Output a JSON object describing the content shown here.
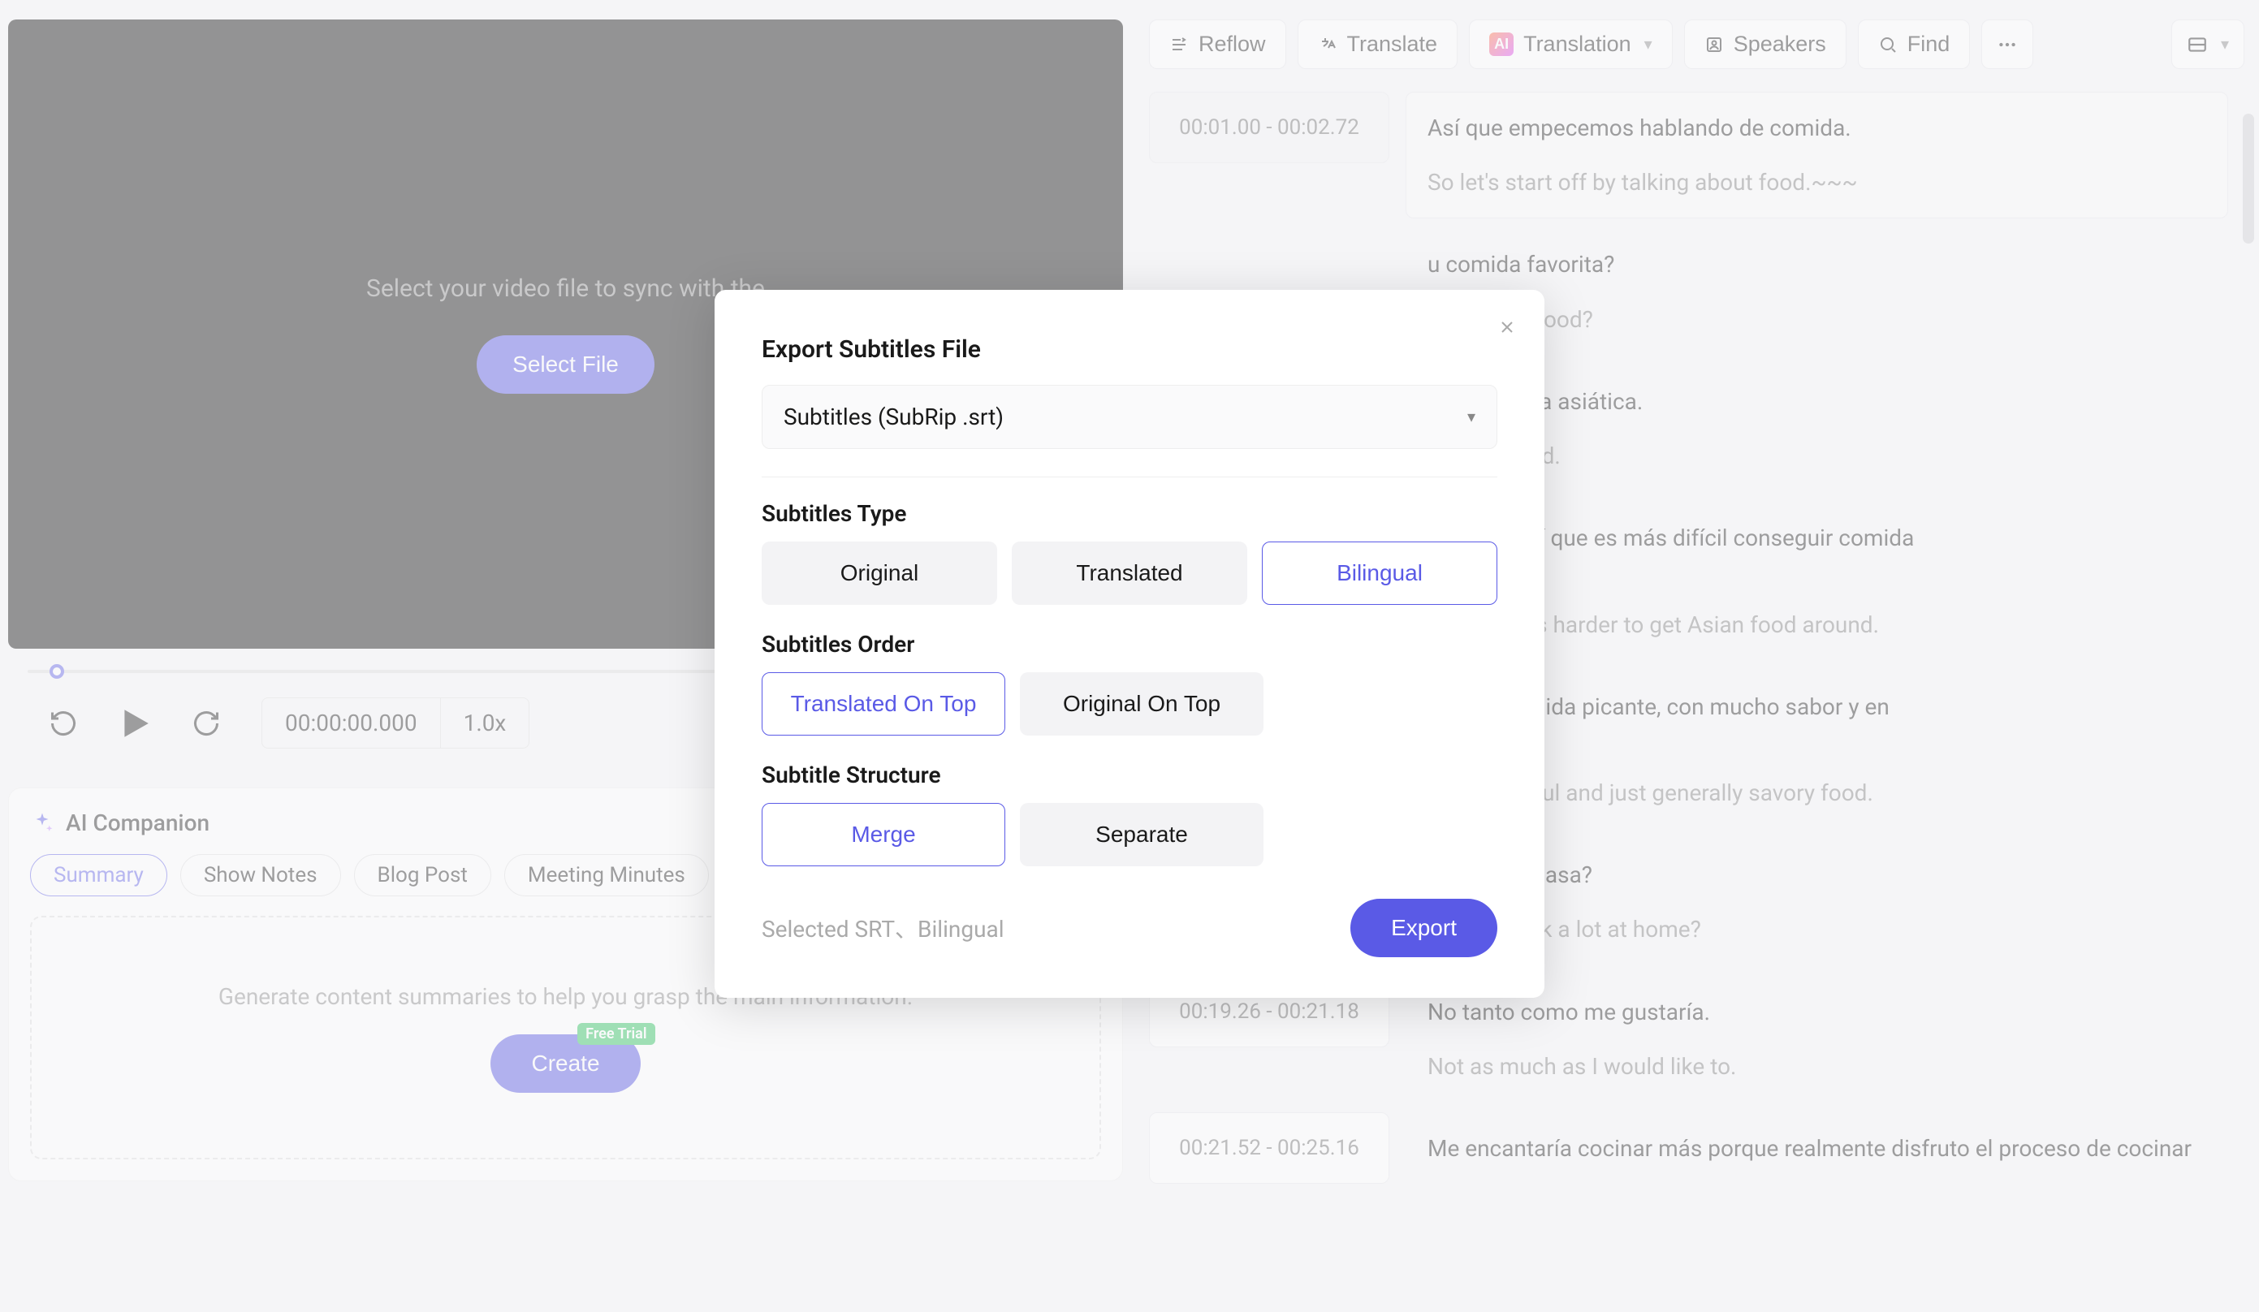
{
  "video": {
    "prompt": "Select your video file to sync with the",
    "select_file": "Select File",
    "timecode": "00:00:00.000",
    "speed": "1.0x"
  },
  "ai": {
    "title": "AI Companion",
    "chips": [
      "Summary",
      "Show Notes",
      "Blog Post",
      "Meeting Minutes"
    ],
    "active_chip": 0,
    "desc": "Generate content summaries to help you grasp the main information.",
    "create": "Create",
    "badge": "Free Trial"
  },
  "toolbar": {
    "reflow": "Reflow",
    "translate": "Translate",
    "translation": "Translation",
    "speakers": "Speakers",
    "find": "Find",
    "ai_badge": "AI"
  },
  "subtitles": [
    {
      "start": "00:01.00",
      "end": "00:02.72",
      "orig": "Así que empecemos hablando de comida.",
      "trans": "So let's start off by talking about food.~~~",
      "active": true
    },
    {
      "start": "",
      "end": "",
      "orig": "u comida favorita?",
      "trans": "ur favorite food?",
      "active": false
    },
    {
      "start": "",
      "end": "",
      "orig": "ta la comida asiática.",
      "trans": "e Asian food.",
      "active": false
    },
    {
      "start": "",
      "end": "",
      "orig": "glaterra, así que es más difícil conseguir comida\nr aquí.",
      "trans": "gland so it's harder to get Asian food around.",
      "active": false
    },
    {
      "start": "",
      "end": "",
      "orig": "usta la comida picante, con mucho sabor y en\nabrosa.",
      "trans": "picy, flavorful and just generally savory food.",
      "active": false
    },
    {
      "start": "",
      "end": "",
      "orig": "mucho en casa?",
      "trans": "Do you cook a lot at home?",
      "active": false
    },
    {
      "start": "00:19.26",
      "end": "00:21.18",
      "orig": "No tanto como me gustaría.",
      "trans": "Not as much as I would like to.",
      "active": false
    },
    {
      "start": "00:21.52",
      "end": "00:25.16",
      "orig": "Me encantaría cocinar más porque realmente disfruto el proceso de cocinar",
      "trans": "",
      "active": false
    }
  ],
  "modal": {
    "title": "Export Subtitles File",
    "format_value": "Subtitles (SubRip .srt)",
    "type_label": "Subtitles Type",
    "types": [
      "Original",
      "Translated",
      "Bilingual"
    ],
    "type_active": 2,
    "order_label": "Subtitles Order",
    "orders": [
      "Translated On Top",
      "Original On Top"
    ],
    "order_active": 0,
    "structure_label": "Subtitle Structure",
    "structures": [
      "Merge",
      "Separate"
    ],
    "structure_active": 0,
    "selected": "Selected SRT、Bilingual",
    "export": "Export"
  }
}
